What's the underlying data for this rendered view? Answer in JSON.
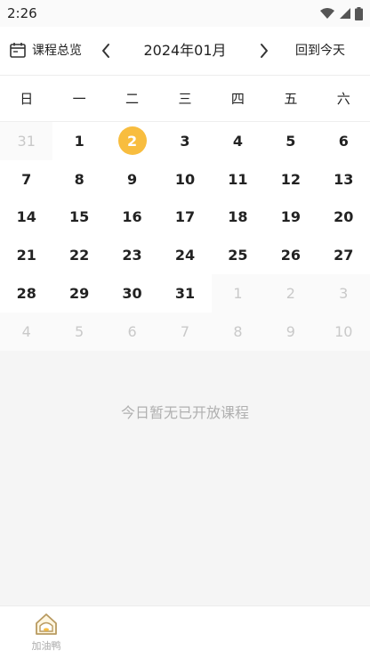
{
  "status": {
    "time": "2:26"
  },
  "header": {
    "overview_label": "课程总览",
    "month": "2024年01月",
    "today_label": "回到今天"
  },
  "weekdays": [
    "日",
    "一",
    "二",
    "三",
    "四",
    "五",
    "六"
  ],
  "days": [
    {
      "n": "31",
      "other": true
    },
    {
      "n": "1"
    },
    {
      "n": "2",
      "today": true
    },
    {
      "n": "3"
    },
    {
      "n": "4"
    },
    {
      "n": "5"
    },
    {
      "n": "6"
    },
    {
      "n": "7"
    },
    {
      "n": "8"
    },
    {
      "n": "9"
    },
    {
      "n": "10"
    },
    {
      "n": "11"
    },
    {
      "n": "12"
    },
    {
      "n": "13"
    },
    {
      "n": "14"
    },
    {
      "n": "15"
    },
    {
      "n": "16"
    },
    {
      "n": "17"
    },
    {
      "n": "18"
    },
    {
      "n": "19"
    },
    {
      "n": "20"
    },
    {
      "n": "21"
    },
    {
      "n": "22"
    },
    {
      "n": "23"
    },
    {
      "n": "24"
    },
    {
      "n": "25"
    },
    {
      "n": "26"
    },
    {
      "n": "27"
    },
    {
      "n": "28"
    },
    {
      "n": "29"
    },
    {
      "n": "30"
    },
    {
      "n": "31"
    },
    {
      "n": "1",
      "other": true
    },
    {
      "n": "2",
      "other": true
    },
    {
      "n": "3",
      "other": true
    },
    {
      "n": "4",
      "other": true
    },
    {
      "n": "5",
      "other": true
    },
    {
      "n": "6",
      "other": true
    },
    {
      "n": "7",
      "other": true
    },
    {
      "n": "8",
      "other": true
    },
    {
      "n": "9",
      "other": true
    },
    {
      "n": "10",
      "other": true
    }
  ],
  "empty_message": "今日暂无已开放课程",
  "tabbar": {
    "home_label": "加油鸭"
  },
  "colors": {
    "accent": "#f8bd3f",
    "muted": "#c9c9c9"
  },
  "icons": {
    "overview": "calendar-icon",
    "prev": "chevron-left-icon",
    "next": "chevron-right-icon",
    "home": "home-icon"
  }
}
